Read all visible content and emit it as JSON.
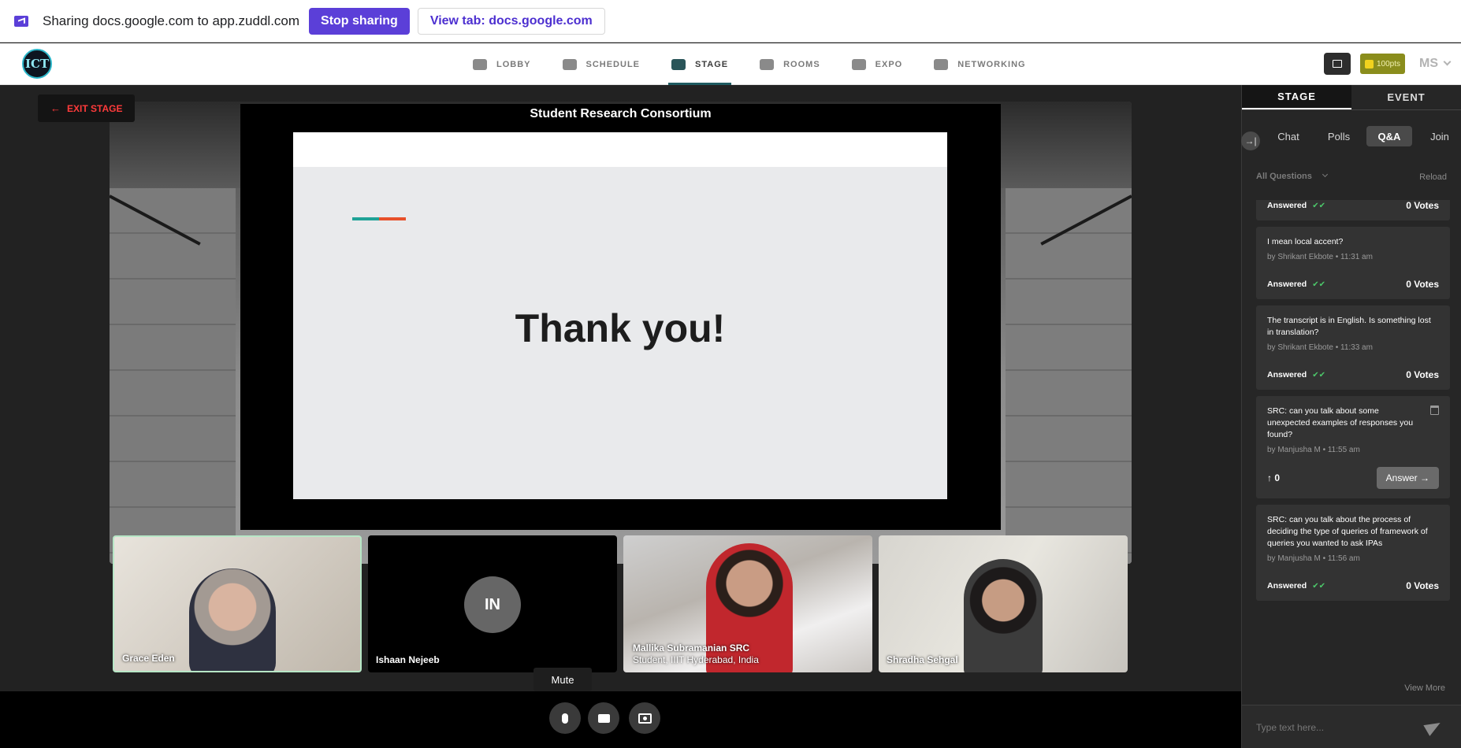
{
  "share_bar": {
    "text": "Sharing docs.google.com to app.zuddl.com",
    "stop_label": "Stop sharing",
    "view_tab_label": "View tab: docs.google.com",
    "accent_color": "#5b3fd8"
  },
  "nav": {
    "logo_text": "ICT",
    "tabs": [
      {
        "label": "LOBBY",
        "icon": "sofa-icon"
      },
      {
        "label": "SCHEDULE",
        "icon": "calendar-icon"
      },
      {
        "label": "STAGE",
        "icon": "stage-icon",
        "active": true
      },
      {
        "label": "ROOMS",
        "icon": "rooms-icon"
      },
      {
        "label": "EXPO",
        "icon": "booth-icon"
      },
      {
        "label": "NETWORKING",
        "icon": "people-icon"
      }
    ],
    "points": "100pts",
    "avatar": "MS"
  },
  "stage": {
    "exit_label": "EXIT STAGE",
    "screen_title": "Student Research Consortium",
    "slide_text": "Thank you!",
    "tiles": [
      {
        "name": "Grace Eden"
      },
      {
        "initials": "IN",
        "name": "Ishaan Nejeeb"
      },
      {
        "name": "Mallika Subramanian SRC",
        "subtitle": "Student, IIIT Hyderabad, India"
      },
      {
        "name": "Shradha Sehgal"
      }
    ],
    "mute_tooltip": "Mute"
  },
  "panel": {
    "tabs": [
      "STAGE",
      "EVENT"
    ],
    "subtabs": [
      "Chat",
      "Polls",
      "Q&A",
      "Join"
    ],
    "filter": "All Questions",
    "reload": "Reload",
    "questions": [
      {
        "status": "Answered",
        "votes": "0 Votes"
      },
      {
        "text": "I mean local accent?",
        "by": "by Shrikant Ekbote • 11:31 am",
        "status": "Answered",
        "votes": "0 Votes"
      },
      {
        "text": "The transcript is in English. Is something lost in translation?",
        "by": "by Shrikant Ekbote • 11:33 am",
        "status": "Answered",
        "votes": "0 Votes"
      },
      {
        "text": "SRC: can you talk about some unexpected examples of responses you found?",
        "by": "by Manjusha M • 11:55 am",
        "upvotes": "0",
        "answer_label": "Answer"
      },
      {
        "text": "SRC: can you talk about the process of deciding the type of queries of framework of queries you wanted to ask IPAs",
        "by": "by Manjusha M • 11:56 am",
        "status": "Answered",
        "votes": "0 Votes"
      }
    ],
    "view_more": "View More",
    "compose_placeholder": "Type text here..."
  }
}
